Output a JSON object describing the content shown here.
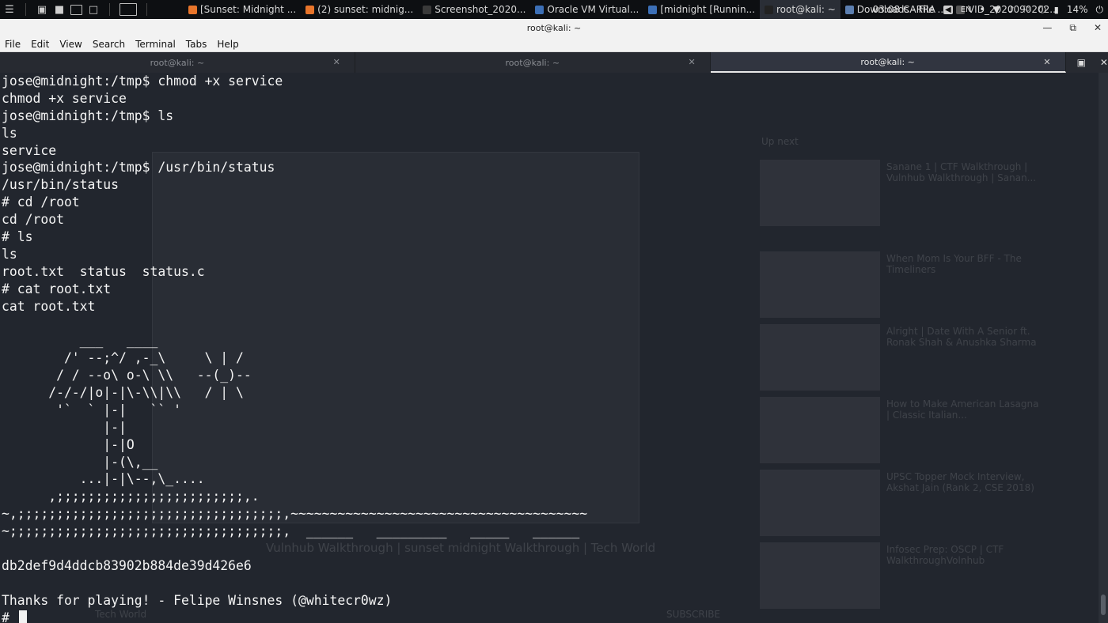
{
  "panel": {
    "tasks": [
      {
        "label": "[Sunset: Midnight ...",
        "icon": "firefox-icon",
        "color": "#e8752b"
      },
      {
        "label": "(2) sunset: midnig...",
        "icon": "firefox-icon",
        "color": "#e8752b"
      },
      {
        "label": "Screenshot_2020...",
        "icon": "image-icon",
        "color": "#3a3a3a"
      },
      {
        "label": "Oracle VM Virtual...",
        "icon": "virtualbox-icon",
        "color": "#3c6fb6"
      },
      {
        "label": "[midnight [Runnin...",
        "icon": "virtualbox-icon",
        "color": "#3c6fb6"
      },
      {
        "label": "root@kali: ~",
        "icon": "terminal-icon",
        "color": "#222222"
      },
      {
        "label": "Downloads - File ...",
        "icon": "folder-icon",
        "color": "#5c7fb0"
      },
      {
        "label": "VID_2020090202...",
        "icon": "video-icon",
        "color": "#555555"
      }
    ],
    "clock": "03:08 CARRA",
    "keyboard_layout": "EN",
    "battery": "14%"
  },
  "window": {
    "title": "root@kali: ~"
  },
  "menu": [
    "File",
    "Edit",
    "View",
    "Search",
    "Terminal",
    "Tabs",
    "Help"
  ],
  "tabs": [
    {
      "label": "root@kali: ~",
      "active": false
    },
    {
      "label": "root@kali: ~",
      "active": false
    },
    {
      "label": "root@kali: ~",
      "active": true
    }
  ],
  "terminal": {
    "lines": [
      "jose@midnight:/tmp$ chmod +x service",
      "chmod +x service",
      "jose@midnight:/tmp$ ls",
      "ls",
      "service",
      "jose@midnight:/tmp$ /usr/bin/status",
      "/usr/bin/status",
      "# cd /root",
      "cd /root",
      "# ls",
      "ls",
      "root.txt  status  status.c",
      "# cat root.txt",
      "cat root.txt",
      "",
      "          ___   ____",
      "        /' --;^/ ,-_\\     \\ | /",
      "       / / --o\\ o-\\ \\\\   --(_)--",
      "      /-/-/|o|-|\\-\\\\|\\\\   / | \\",
      "       '`  ` |-|   `` '",
      "             |-|",
      "             |-|O",
      "             |-(\\,__",
      "          ...|-|\\--,\\_....",
      "      ,;;;;;;;;;;;;;;;;;;;;;;;;,.",
      "~,;;;;;;;;;;;;;;;;;;;;;;;;;;;;;;;;;;,~~~~~~~~~~~~~~~~~~~~~~~~~~~~~~~~~~~~~~",
      "~;;;;;;;;;;;;;;;;;;;;;;;;;;;;;;;;;;;,  ______   _________   _____   ______",
      "",
      "db2def9d4ddcb83902b884de39d426e6",
      "",
      "Thanks for playing! - Felipe Winsnes (@whitecr0wz)"
    ],
    "prompt": "# ",
    "background_ghost_text": {
      "up_next": "Up next",
      "video_title": "Vulnhub Walkthrough | sunset midnight Walkthrough | Tech World",
      "channel": "Tech World",
      "subscribe": "SUBSCRIBE",
      "sidebar_items": [
        "Sanane 1 | CTF Walkthrough | Vulnhub Walkthrough | Sanan...",
        "When Mom Is Your BFF - The Timeliners",
        "Alright | Date With A Senior ft. Ronak Shah & Anushka Sharma",
        "How to Make American Lasagna | Classic Italian...",
        "UPSC Topper Mock Interview, Akshat Jain (Rank 2, CSE 2018)",
        "Infosec Prep: OSCP | CTF WalkthroughVolnhub"
      ]
    }
  }
}
